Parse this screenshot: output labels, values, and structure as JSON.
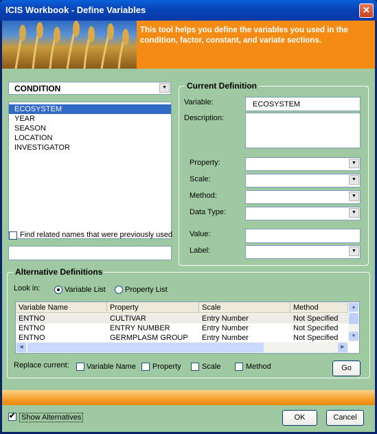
{
  "window": {
    "title": "ICIS Workbook - Define Variables",
    "close_glyph": "✕"
  },
  "banner": {
    "text": "This tool helps you define the variables you used in the condition, factor, constant, and variate sections."
  },
  "section_select": {
    "value": "CONDITION"
  },
  "variable_list": [
    "ECOSYSTEM",
    "YEAR",
    "SEASON",
    "LOCATION",
    "INVESTIGATOR"
  ],
  "find_related": {
    "label": "Find related names that were previously used"
  },
  "current_definition": {
    "title": "Current Definition",
    "variable_label": "Variable:",
    "variable_value": "ECOSYSTEM",
    "description_label": "Description:",
    "property_label": "Property:",
    "scale_label": "Scale:",
    "method_label": "Method:",
    "datatype_label": "Data Type:",
    "value_label": "Value:",
    "label_label": "Label:"
  },
  "alternative": {
    "title": "Alternative Definitions",
    "look_in_label": "Look in:",
    "radio_variable": "Variable List",
    "radio_property": "Property List",
    "columns": [
      "Variable Name",
      "Property",
      "Scale",
      "Method"
    ],
    "rows": [
      [
        "ENTNO",
        "CULTIVAR",
        "Entry Number",
        "Not Specified"
      ],
      [
        "ENTNO",
        "ENTRY NUMBER",
        "Entry Number",
        "Not Specified"
      ],
      [
        "ENTNO",
        "GERMPLASM GROUP",
        "Entry Number",
        "Not Specified"
      ]
    ],
    "replace_label": "Replace current:",
    "chk_variable": "Variable Name",
    "chk_property": "Property",
    "chk_scale": "Scale",
    "chk_method": "Method",
    "go": "Go"
  },
  "footer": {
    "show_alternatives": "Show Alternatives",
    "ok": "OK",
    "cancel": "Cancel"
  },
  "colors": {
    "panel": "#9fc9a0",
    "banner": "#f48b15",
    "selection": "#3169c6"
  }
}
